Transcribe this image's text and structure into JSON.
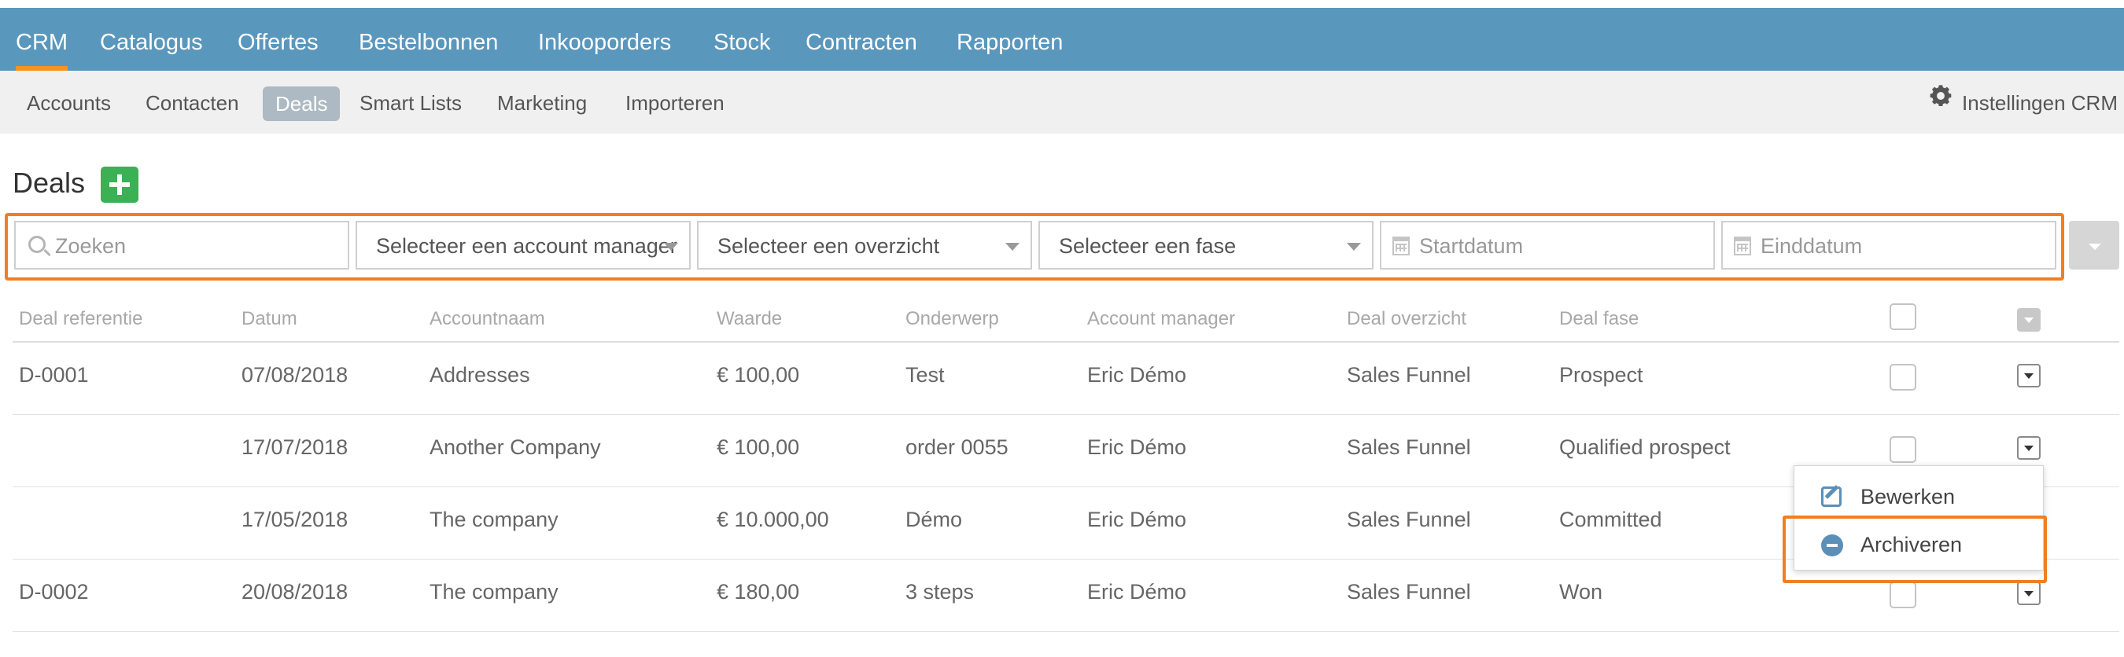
{
  "topnav": {
    "items": [
      "CRM",
      "Catalogus",
      "Offertes",
      "Bestelbonnen",
      "Inkooporders",
      "Stock",
      "Contracten",
      "Rapporten"
    ],
    "active": "CRM"
  },
  "subnav": {
    "items": [
      "Accounts",
      "Contacten",
      "Deals",
      "Smart Lists",
      "Marketing",
      "Importeren"
    ],
    "active": "Deals",
    "settings_label": "Instellingen CRM",
    "settings_icon": "gear-icon"
  },
  "page": {
    "title": "Deals",
    "add_icon": "plus-icon",
    "add_color": "#3cb054"
  },
  "filters": {
    "search_placeholder": "Zoeken",
    "account_manager": "Selecteer een account manager",
    "overview": "Selecteer een overzicht",
    "phase": "Selecteer een fase",
    "start_placeholder": "Startdatum",
    "end_placeholder": "Einddatum",
    "highlight_color": "#f07f23"
  },
  "table": {
    "headers": [
      "Deal referentie",
      "Datum",
      "Accountnaam",
      "Waarde",
      "Onderwerp",
      "Account manager",
      "Deal overzicht",
      "Deal fase"
    ],
    "rows": [
      [
        "D-0001",
        "07/08/2018",
        "Addresses",
        "€ 100,00",
        "Test",
        "Eric Démo",
        "Sales Funnel",
        "Prospect"
      ],
      [
        "",
        "17/07/2018",
        "Another Company",
        "€ 100,00",
        "order 0055",
        "Eric Démo",
        "Sales Funnel",
        "Qualified prospect"
      ],
      [
        "",
        "17/05/2018",
        "The company",
        "€ 10.000,00",
        "Démo",
        "Eric Démo",
        "Sales Funnel",
        "Committed"
      ],
      [
        "D-0002",
        "20/08/2018",
        "The company",
        "€ 180,00",
        "3 steps",
        "Eric Démo",
        "Sales Funnel",
        "Won"
      ]
    ]
  },
  "row_menu": {
    "edit_label": "Bewerken",
    "archive_label": "Archiveren",
    "edit_icon": "edit-icon",
    "archive_icon": "minus-circle-icon"
  },
  "colors": {
    "topnav_bg": "#5a97bd",
    "active_underline": "#f7941d",
    "subnav_bg": "#f0f0f0",
    "icon_blue": "#5a8fb8"
  }
}
